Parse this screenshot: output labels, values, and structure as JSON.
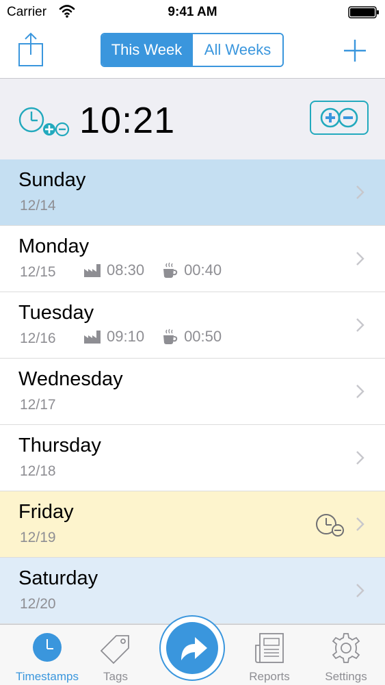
{
  "status_bar": {
    "carrier": "Carrier",
    "time": "9:41 AM"
  },
  "nav": {
    "segments": [
      {
        "label": "This Week",
        "active": true
      },
      {
        "label": "All Weeks",
        "active": false
      }
    ]
  },
  "summary": {
    "time": "10:21"
  },
  "days": [
    {
      "name": "Sunday",
      "date": "12/14"
    },
    {
      "name": "Monday",
      "date": "12/15",
      "work": "08:30",
      "break": "00:40"
    },
    {
      "name": "Tuesday",
      "date": "12/16",
      "work": "09:10",
      "break": "00:50"
    },
    {
      "name": "Wednesday",
      "date": "12/17"
    },
    {
      "name": "Thursday",
      "date": "12/18"
    },
    {
      "name": "Friday",
      "date": "12/19"
    },
    {
      "name": "Saturday",
      "date": "12/20"
    }
  ],
  "tabs": [
    {
      "label": "Timestamps",
      "icon": "clock-icon"
    },
    {
      "label": "Tags",
      "icon": "tag-icon"
    },
    {
      "label": "Reports",
      "icon": "report-icon"
    },
    {
      "label": "Settings",
      "icon": "gear-icon"
    }
  ],
  "colors": {
    "accent": "#3a96dd",
    "teal": "#22a9bd",
    "today": "#c5dff2",
    "friday": "#fdf4cd",
    "saturday": "#dfecf8"
  }
}
